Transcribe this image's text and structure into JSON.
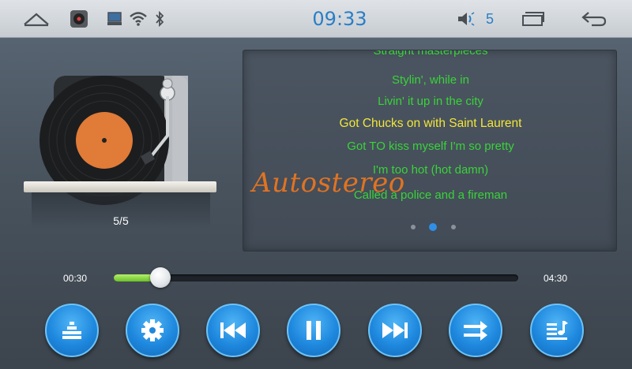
{
  "status_bar": {
    "clock": "09:33",
    "volume_level": "5",
    "icons": [
      "home-icon",
      "media-app-icon",
      "screen-icon",
      "wifi-icon",
      "bluetooth-icon",
      "volume-icon",
      "recent-apps-icon",
      "back-icon"
    ]
  },
  "player": {
    "track_counter": "5/5",
    "elapsed": "00:30",
    "duration": "04:30",
    "progress_fraction": 0.115
  },
  "lyrics": {
    "lines": [
      "Straight masterpieces",
      "Stylin', while in",
      "Livin' it up in the city",
      "Got Chucks on with Saint Laurent",
      "Got TO kiss myself I'm so pretty",
      "I'm too hot (hot damn)",
      "Called a police and a fireman"
    ],
    "active_index": 3,
    "pages": 3,
    "active_page": 1
  },
  "watermark": "Autostereo",
  "controls": [
    "equalizer-icon",
    "settings-icon",
    "previous-icon",
    "pause-icon",
    "next-icon",
    "shuffle-icon",
    "playlist-icon"
  ],
  "colors": {
    "accent_blue": "#2a7ec6",
    "lyric_green": "#39d33a",
    "lyric_active": "#f2e63a",
    "progress_green": "#6cc22a",
    "button_blue": "#1e88de"
  }
}
